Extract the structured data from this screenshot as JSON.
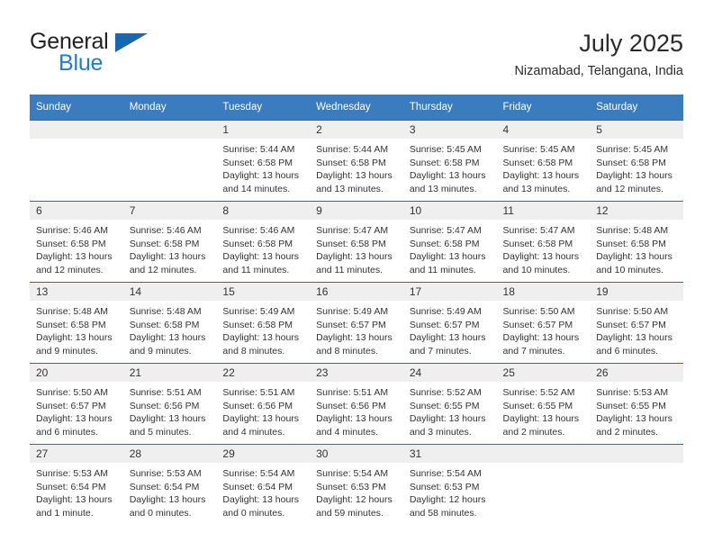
{
  "brand": {
    "word1": "General",
    "word2": "Blue",
    "triangle_color": "#1668b3",
    "blue_color": "#1d7dd4"
  },
  "header": {
    "title": "July 2025",
    "location": "Nizamabad, Telangana, India"
  },
  "theme": {
    "header_bg": "#3a7cbe",
    "row_divider": "#2e6da4",
    "daynum_bg": "#efefef",
    "text": "#333333"
  },
  "calendar": {
    "weekday_headers": [
      "Sunday",
      "Monday",
      "Tuesday",
      "Wednesday",
      "Thursday",
      "Friday",
      "Saturday"
    ],
    "weeks": [
      [
        {
          "day": "",
          "sunrise": "",
          "sunset": "",
          "daylight": ""
        },
        {
          "day": "",
          "sunrise": "",
          "sunset": "",
          "daylight": ""
        },
        {
          "day": "1",
          "sunrise": "Sunrise: 5:44 AM",
          "sunset": "Sunset: 6:58 PM",
          "daylight": "Daylight: 13 hours and 14 minutes."
        },
        {
          "day": "2",
          "sunrise": "Sunrise: 5:44 AM",
          "sunset": "Sunset: 6:58 PM",
          "daylight": "Daylight: 13 hours and 13 minutes."
        },
        {
          "day": "3",
          "sunrise": "Sunrise: 5:45 AM",
          "sunset": "Sunset: 6:58 PM",
          "daylight": "Daylight: 13 hours and 13 minutes."
        },
        {
          "day": "4",
          "sunrise": "Sunrise: 5:45 AM",
          "sunset": "Sunset: 6:58 PM",
          "daylight": "Daylight: 13 hours and 13 minutes."
        },
        {
          "day": "5",
          "sunrise": "Sunrise: 5:45 AM",
          "sunset": "Sunset: 6:58 PM",
          "daylight": "Daylight: 13 hours and 12 minutes."
        }
      ],
      [
        {
          "day": "6",
          "sunrise": "Sunrise: 5:46 AM",
          "sunset": "Sunset: 6:58 PM",
          "daylight": "Daylight: 13 hours and 12 minutes."
        },
        {
          "day": "7",
          "sunrise": "Sunrise: 5:46 AM",
          "sunset": "Sunset: 6:58 PM",
          "daylight": "Daylight: 13 hours and 12 minutes."
        },
        {
          "day": "8",
          "sunrise": "Sunrise: 5:46 AM",
          "sunset": "Sunset: 6:58 PM",
          "daylight": "Daylight: 13 hours and 11 minutes."
        },
        {
          "day": "9",
          "sunrise": "Sunrise: 5:47 AM",
          "sunset": "Sunset: 6:58 PM",
          "daylight": "Daylight: 13 hours and 11 minutes."
        },
        {
          "day": "10",
          "sunrise": "Sunrise: 5:47 AM",
          "sunset": "Sunset: 6:58 PM",
          "daylight": "Daylight: 13 hours and 11 minutes."
        },
        {
          "day": "11",
          "sunrise": "Sunrise: 5:47 AM",
          "sunset": "Sunset: 6:58 PM",
          "daylight": "Daylight: 13 hours and 10 minutes."
        },
        {
          "day": "12",
          "sunrise": "Sunrise: 5:48 AM",
          "sunset": "Sunset: 6:58 PM",
          "daylight": "Daylight: 13 hours and 10 minutes."
        }
      ],
      [
        {
          "day": "13",
          "sunrise": "Sunrise: 5:48 AM",
          "sunset": "Sunset: 6:58 PM",
          "daylight": "Daylight: 13 hours and 9 minutes."
        },
        {
          "day": "14",
          "sunrise": "Sunrise: 5:48 AM",
          "sunset": "Sunset: 6:58 PM",
          "daylight": "Daylight: 13 hours and 9 minutes."
        },
        {
          "day": "15",
          "sunrise": "Sunrise: 5:49 AM",
          "sunset": "Sunset: 6:58 PM",
          "daylight": "Daylight: 13 hours and 8 minutes."
        },
        {
          "day": "16",
          "sunrise": "Sunrise: 5:49 AM",
          "sunset": "Sunset: 6:57 PM",
          "daylight": "Daylight: 13 hours and 8 minutes."
        },
        {
          "day": "17",
          "sunrise": "Sunrise: 5:49 AM",
          "sunset": "Sunset: 6:57 PM",
          "daylight": "Daylight: 13 hours and 7 minutes."
        },
        {
          "day": "18",
          "sunrise": "Sunrise: 5:50 AM",
          "sunset": "Sunset: 6:57 PM",
          "daylight": "Daylight: 13 hours and 7 minutes."
        },
        {
          "day": "19",
          "sunrise": "Sunrise: 5:50 AM",
          "sunset": "Sunset: 6:57 PM",
          "daylight": "Daylight: 13 hours and 6 minutes."
        }
      ],
      [
        {
          "day": "20",
          "sunrise": "Sunrise: 5:50 AM",
          "sunset": "Sunset: 6:57 PM",
          "daylight": "Daylight: 13 hours and 6 minutes."
        },
        {
          "day": "21",
          "sunrise": "Sunrise: 5:51 AM",
          "sunset": "Sunset: 6:56 PM",
          "daylight": "Daylight: 13 hours and 5 minutes."
        },
        {
          "day": "22",
          "sunrise": "Sunrise: 5:51 AM",
          "sunset": "Sunset: 6:56 PM",
          "daylight": "Daylight: 13 hours and 4 minutes."
        },
        {
          "day": "23",
          "sunrise": "Sunrise: 5:51 AM",
          "sunset": "Sunset: 6:56 PM",
          "daylight": "Daylight: 13 hours and 4 minutes."
        },
        {
          "day": "24",
          "sunrise": "Sunrise: 5:52 AM",
          "sunset": "Sunset: 6:55 PM",
          "daylight": "Daylight: 13 hours and 3 minutes."
        },
        {
          "day": "25",
          "sunrise": "Sunrise: 5:52 AM",
          "sunset": "Sunset: 6:55 PM",
          "daylight": "Daylight: 13 hours and 2 minutes."
        },
        {
          "day": "26",
          "sunrise": "Sunrise: 5:53 AM",
          "sunset": "Sunset: 6:55 PM",
          "daylight": "Daylight: 13 hours and 2 minutes."
        }
      ],
      [
        {
          "day": "27",
          "sunrise": "Sunrise: 5:53 AM",
          "sunset": "Sunset: 6:54 PM",
          "daylight": "Daylight: 13 hours and 1 minute."
        },
        {
          "day": "28",
          "sunrise": "Sunrise: 5:53 AM",
          "sunset": "Sunset: 6:54 PM",
          "daylight": "Daylight: 13 hours and 0 minutes."
        },
        {
          "day": "29",
          "sunrise": "Sunrise: 5:54 AM",
          "sunset": "Sunset: 6:54 PM",
          "daylight": "Daylight: 13 hours and 0 minutes."
        },
        {
          "day": "30",
          "sunrise": "Sunrise: 5:54 AM",
          "sunset": "Sunset: 6:53 PM",
          "daylight": "Daylight: 12 hours and 59 minutes."
        },
        {
          "day": "31",
          "sunrise": "Sunrise: 5:54 AM",
          "sunset": "Sunset: 6:53 PM",
          "daylight": "Daylight: 12 hours and 58 minutes."
        },
        {
          "day": "",
          "sunrise": "",
          "sunset": "",
          "daylight": ""
        },
        {
          "day": "",
          "sunrise": "",
          "sunset": "",
          "daylight": ""
        }
      ]
    ]
  }
}
